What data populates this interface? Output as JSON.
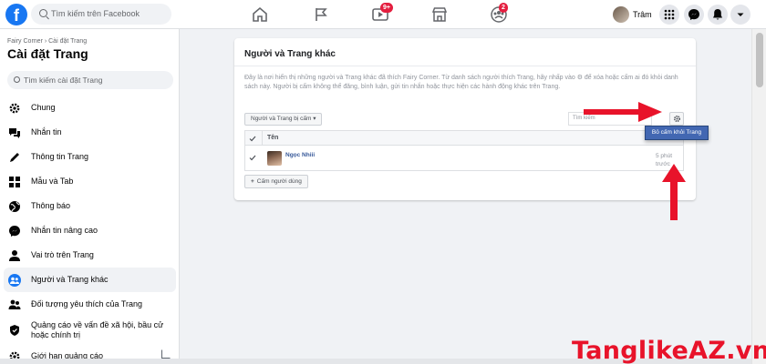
{
  "topbar": {
    "logo_letter": "f",
    "search_placeholder": "Tìm kiếm trên Facebook",
    "watch_badge": "9+",
    "groups_badge": "2",
    "user_name": "Trâm"
  },
  "sidebar": {
    "breadcrumb": "Fairy Corner › Cài đặt Trang",
    "title": "Cài đặt Trang",
    "search_placeholder": "Tìm kiếm cài đặt Trang",
    "items": [
      {
        "label": "Chung",
        "icon": "gear-icon"
      },
      {
        "label": "Nhắn tin",
        "icon": "chat-icon"
      },
      {
        "label": "Thông tin Trang",
        "icon": "pencil-icon"
      },
      {
        "label": "Mẫu và Tab",
        "icon": "grid-icon"
      },
      {
        "label": "Thông báo",
        "icon": "globe-icon"
      },
      {
        "label": "Nhắn tin nâng cao",
        "icon": "messenger-icon"
      },
      {
        "label": "Vai trò trên Trang",
        "icon": "person-icon"
      },
      {
        "label": "Người và Trang khác",
        "icon": "people-icon"
      },
      {
        "label": "Đối tượng yêu thích của Trang",
        "icon": "audience-icon"
      },
      {
        "label": "Quảng cáo về vấn đề xã hội, bầu cử hoặc chính trị",
        "icon": "shield-icon"
      },
      {
        "label": "Giới hạn quảng cáo",
        "icon": "gear-icon"
      }
    ],
    "active_index": 7
  },
  "card": {
    "title": "Người và Trang khác",
    "description": "Đây là nơi hiển thị những người và Trang khác đã thích Fairy Corner. Từ danh sách người thích Trang, hãy nhấp vào ⚙ để xóa hoặc cấm ai đó khỏi danh sách này. Người bị cấm không thể đăng, bình luận, gửi tin nhắn hoặc thực hiện các hành động khác trên Trang.",
    "filter_label": "Người và Trang bị cấm ▾",
    "search_placeholder": "Tìm kiếm",
    "column_name": "Tên",
    "rows": [
      {
        "name": "Ngọc Nhiii",
        "time": "5 phút trước"
      }
    ],
    "add_button_label": "Cấm người dùng",
    "add_button_plus": "+"
  },
  "dropdown": {
    "label": "Bỏ cấm khỏi Trang"
  },
  "watermark": "TanglikeAZ.vn",
  "colors": {
    "fb_blue": "#1877f2",
    "link_blue": "#365899",
    "button_blue": "#4267b2",
    "arrow_red": "#e8132a"
  }
}
